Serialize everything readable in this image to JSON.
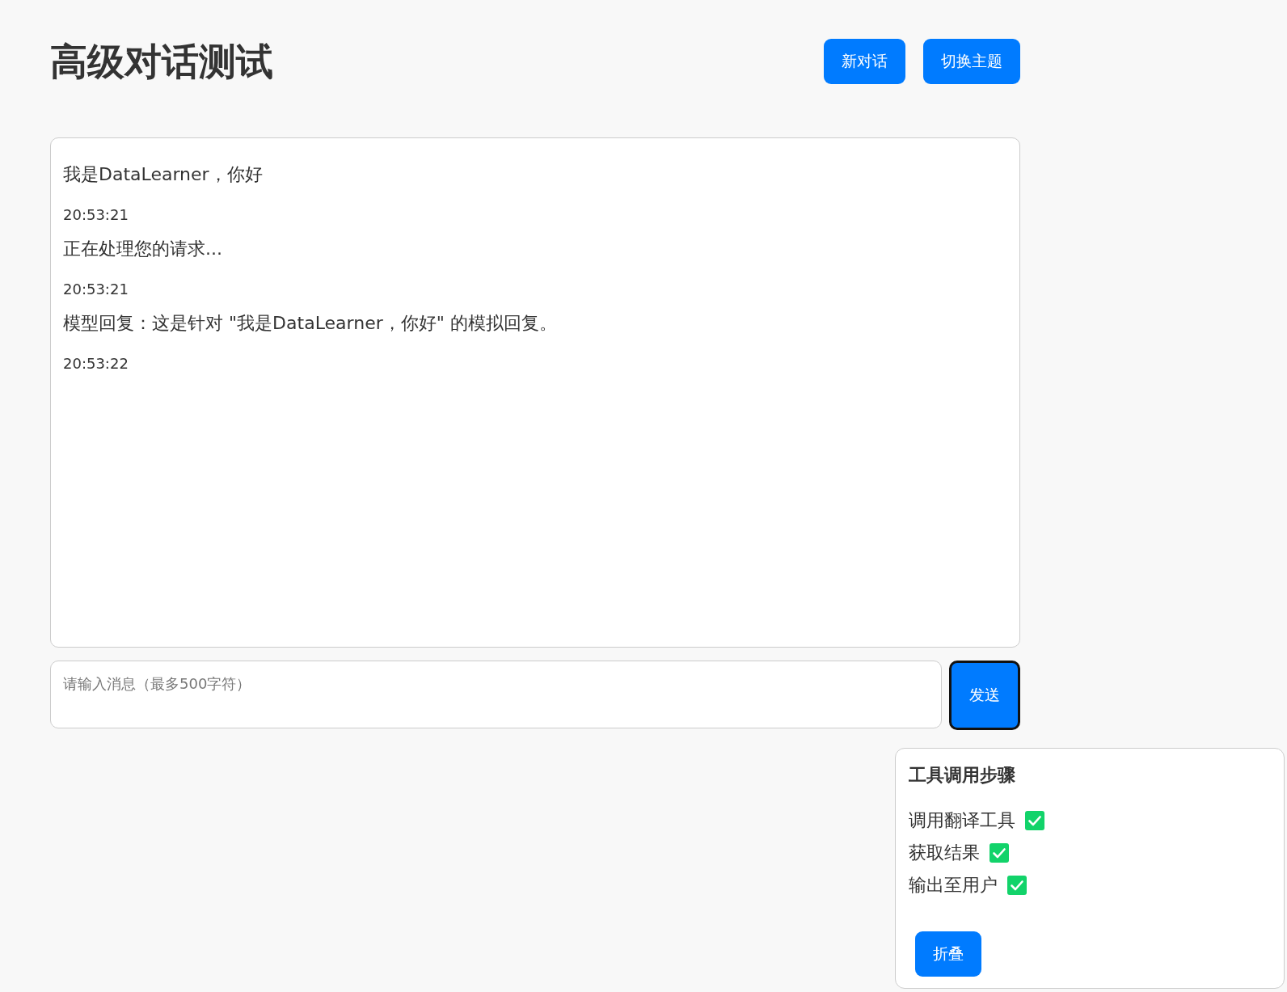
{
  "header": {
    "title": "高级对话测试",
    "buttons": [
      "新对话",
      "切换主题"
    ]
  },
  "messages": [
    {
      "text": "我是DataLearner，你好",
      "time": "20:53:21"
    },
    {
      "text": "正在处理您的请求...",
      "time": "20:53:21"
    },
    {
      "text": "模型回复：这是针对 \"我是DataLearner，你好\" 的模拟回复。",
      "time": "20:53:22"
    }
  ],
  "composer": {
    "placeholder": "请输入消息（最多500字符）",
    "send": "发送"
  },
  "tool_steps": {
    "title": "工具调用步骤",
    "steps": [
      {
        "label": "调用翻译工具",
        "checked": true
      },
      {
        "label": "获取结果",
        "checked": true
      },
      {
        "label": "输出至用户",
        "checked": true
      }
    ],
    "button": "折叠"
  }
}
